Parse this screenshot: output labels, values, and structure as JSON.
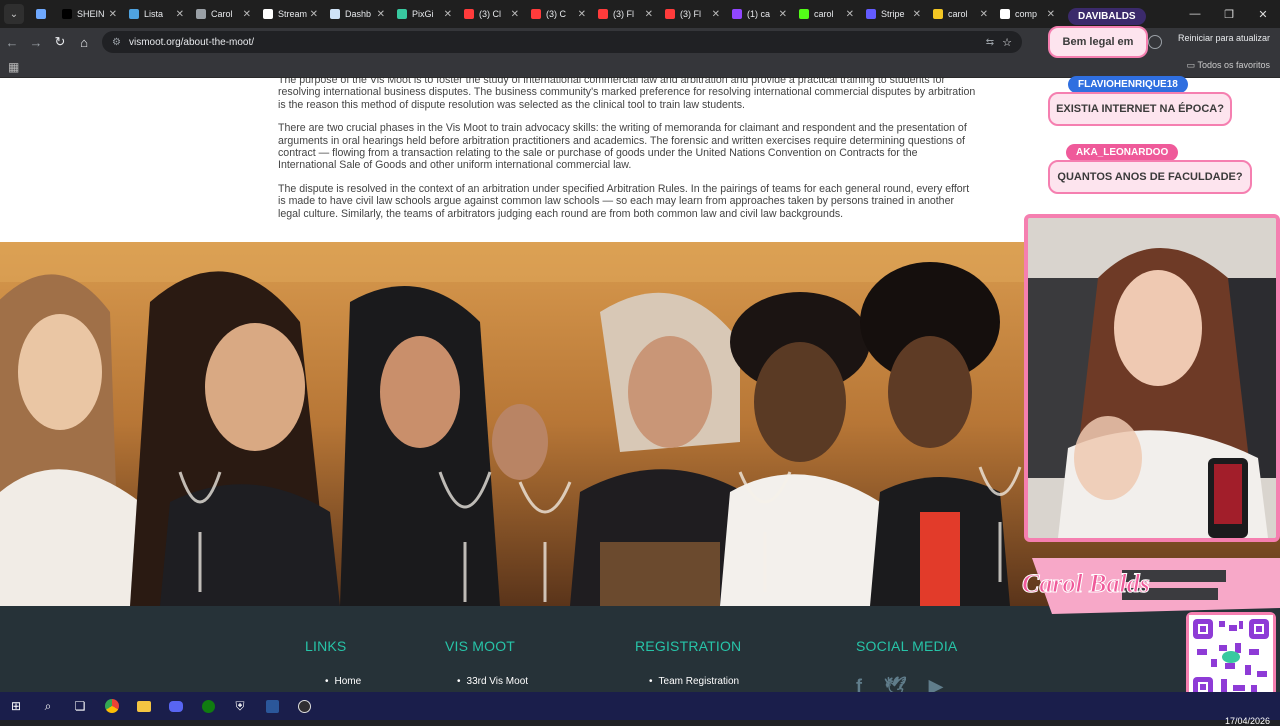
{
  "browser": {
    "tabs": [
      {
        "label": "",
        "color": "#6ea8fe"
      },
      {
        "label": "SHEIN",
        "color": "#000000"
      },
      {
        "label": "Lista",
        "color": "#4fa3e0"
      },
      {
        "label": "Carol",
        "color": "#9aa0a6"
      },
      {
        "label": "Stream",
        "color": "#ffffff"
      },
      {
        "label": "Dashb",
        "color": "#cfe3f7"
      },
      {
        "label": "PixGi",
        "color": "#38c9a0"
      },
      {
        "label": "(3) Cl",
        "color": "#ff3b3b"
      },
      {
        "label": "(3) C",
        "color": "#ff3b3b"
      },
      {
        "label": "(3) Fl",
        "color": "#ff3b3b"
      },
      {
        "label": "(3) Fl",
        "color": "#ff3b3b"
      },
      {
        "label": "(1) ca",
        "color": "#9146ff"
      },
      {
        "label": "carol",
        "color": "#53fc18"
      },
      {
        "label": "Stripe",
        "color": "#635bff"
      },
      {
        "label": "carol",
        "color": "#f3c623"
      },
      {
        "label": "comp",
        "color": "#ffffff"
      }
    ],
    "url": "vismoot.org/about-the-moot/",
    "update_button": "Reiniciar para atualizar",
    "bookmarks_folder": "Todos os favoritos"
  },
  "article": {
    "paragraphs": [
      "The purpose of the Vis Moot is to foster the study of international commercial law and arbitration and provide a practical training to students for resolving international business disputes. The business community's marked preference for resolving international commercial disputes by arbitration is the reason this method of dispute resolution was selected as the clinical tool to train law students.",
      "There are two crucial phases in the Vis Moot to train advocacy skills: the writing of memoranda for claimant and respondent and the presentation of arguments in oral hearings held before arbitration practitioners and academics. The forensic and written exercises require determining questions of contract — flowing from a transaction relating to the sale or purchase of goods under the United Nations Convention on Contracts for the International Sale of Goods and other uniform international commercial law.",
      "The dispute is resolved in the context of an arbitration under specified Arbitration Rules. In the pairings of teams for each general round, every effort is made to have civil law schools argue against common law schools — so each may learn from approaches taken by persons trained in another legal culture. Similarly, the teams of arbitrators judging each round are from both common law and civil law backgrounds."
    ]
  },
  "footer": {
    "links_title": "LINKS",
    "links_item": "Home",
    "vismoot_title": "VIS MOOT",
    "vismoot_item": "33rd Vis Moot",
    "registration_title": "REGISTRATION",
    "registration_item": "Team Registration",
    "social_title": "SOCIAL MEDIA"
  },
  "overlay": {
    "chat": [
      {
        "user": "DAVIBALDS",
        "message": "Bem legal em"
      },
      {
        "user": "FLAVIOHENRIQUE18",
        "message": "EXISTIA INTERNET NA ÉPOCA?"
      },
      {
        "user": "AKA_LEONARDOO",
        "message": "QUANTOS ANOS DE FACULDADE?"
      }
    ],
    "brand": "Carol Balds"
  },
  "taskbar": {
    "date": "17/04/2026"
  }
}
